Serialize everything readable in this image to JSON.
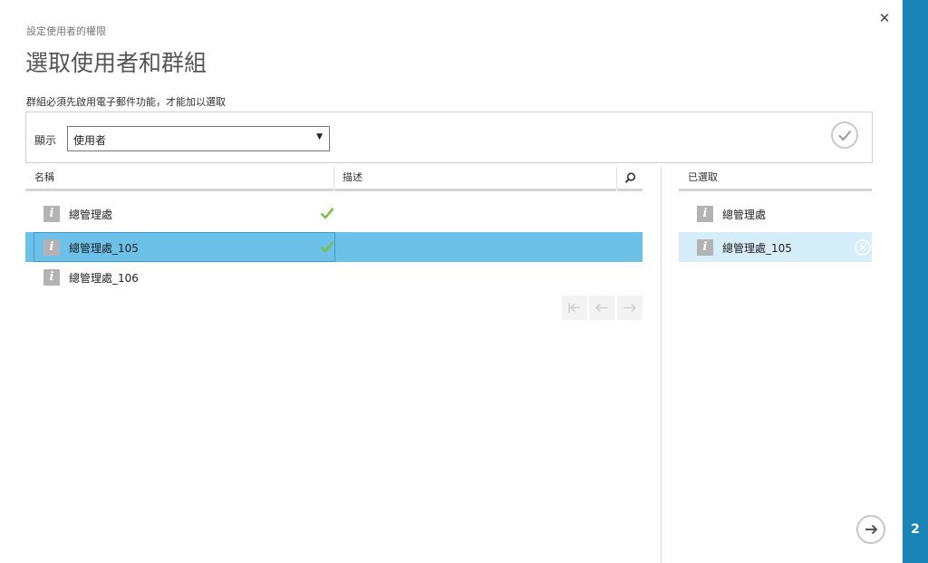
{
  "breadcrumb": "設定使用者的權限",
  "title": "選取使用者和群組",
  "instruction": "群組必須先啟用電子郵件功能，才能加以選取",
  "filter": {
    "label": "顯示",
    "selected": "使用者"
  },
  "columns": {
    "name": "名稱",
    "description": "描述"
  },
  "rows": [
    {
      "name": "總管理處",
      "checked": true,
      "selected": false
    },
    {
      "name": "總管理處_105",
      "checked": true,
      "selected": true
    },
    {
      "name": "總管理處_106",
      "checked": false,
      "selected": false
    }
  ],
  "selected_panel": {
    "header": "已選取",
    "items": [
      {
        "name": "總管理處"
      },
      {
        "name": "總管理處_105"
      }
    ]
  },
  "step": "2",
  "colors": {
    "accent": "#1b84b6",
    "row_selected": "#6bc1e8",
    "check": "#7cc142"
  },
  "icons": [
    "close-icon",
    "info-icon",
    "check-icon",
    "search-icon",
    "first-page-icon",
    "prev-page-icon",
    "next-page-icon",
    "remove-icon",
    "arrow-right-icon",
    "dropdown-arrow-icon"
  ]
}
